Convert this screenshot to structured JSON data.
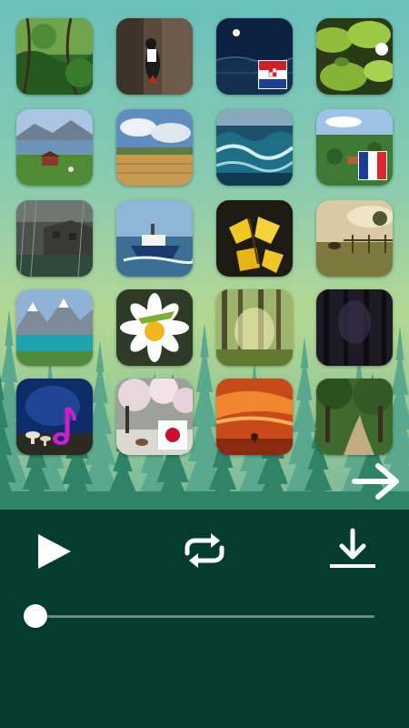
{
  "colors": {
    "control_bar": "#043d30",
    "sky_top": "#69c0bb",
    "forest_dark": "#1f6e57",
    "accent_white": "#ffffff",
    "note_magenta": "#cc1fc8"
  },
  "grid": {
    "tiles": [
      {
        "scene": "jungle-vines",
        "badge": null
      },
      {
        "scene": "woodpecker-on-tree",
        "badge": null
      },
      {
        "scene": "night-sea",
        "badge": "croatia-flag"
      },
      {
        "scene": "frog-on-lily-pads",
        "badge": null
      },
      {
        "scene": "lakeside-farm",
        "badge": null
      },
      {
        "scene": "field-under-clouds",
        "badge": null
      },
      {
        "scene": "ocean-waves",
        "badge": null
      },
      {
        "scene": "french-countryside",
        "badge": "france-flag"
      },
      {
        "scene": "rainy-village",
        "badge": null
      },
      {
        "scene": "police-boat",
        "badge": null
      },
      {
        "scene": "yellow-autumn-leaves",
        "badge": null
      },
      {
        "scene": "misty-pasture-horses",
        "badge": null
      },
      {
        "scene": "alpine-lake",
        "badge": null
      },
      {
        "scene": "grasshopper-on-daisy",
        "badge": null
      },
      {
        "scene": "sunlit-forest",
        "badge": null
      },
      {
        "scene": "dark-forest",
        "badge": null
      },
      {
        "scene": "night-mushrooms",
        "badge": "music-note"
      },
      {
        "scene": "cherry-blossom-deer",
        "badge": "japan-flag"
      },
      {
        "scene": "orange-sunset-tree",
        "badge": null
      },
      {
        "scene": "forest-path",
        "badge": null
      }
    ]
  },
  "navigation": {
    "next_page_icon": "arrow-right-icon"
  },
  "player": {
    "play_icon": "play-icon",
    "repeat_icon": "repeat-icon",
    "download_icon": "download-icon",
    "progress": 0.0
  }
}
